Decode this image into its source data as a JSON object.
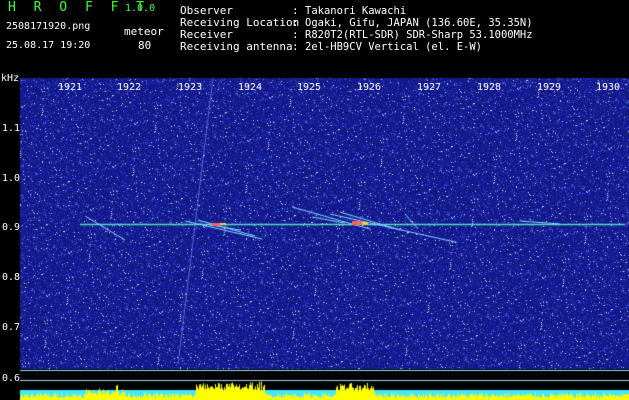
{
  "header": {
    "app_title": "H R O F F T",
    "app_version": "1.0.0",
    "filename": "2508171920.png",
    "meteor_label": "meteor",
    "datetime": "25.08.17 19:20",
    "meteor_count": "80",
    "info": [
      {
        "label": "Observer",
        "value": "Takanori Kawachi"
      },
      {
        "label": "Receiving Location",
        "value": "Ogaki, Gifu, JAPAN (136.60E, 35.35N)"
      },
      {
        "label": "Receiver",
        "value": "R820T2(RTL-SDR) SDR-Sharp 53.1000MHz"
      },
      {
        "label": "Receiving antenna",
        "value": "2el-HB9CV Vertical (el. E-W)"
      }
    ],
    "colon": ":"
  },
  "spectrogram": {
    "y_unit": "kHz",
    "y_ticks": [
      "1.1",
      "1.0",
      "0.9",
      "0.8",
      "0.7",
      "0.6"
    ],
    "x_ticks": [
      "1921",
      "1922",
      "1923",
      "1924",
      "1925",
      "1926",
      "1927",
      "1928",
      "1929",
      "1930"
    ]
  },
  "colors": {
    "background": "#000000",
    "noise": "#1c2a9a",
    "carrier": "#4fe0c0",
    "bars": "#ffff00",
    "title": "#3cff3c"
  }
}
